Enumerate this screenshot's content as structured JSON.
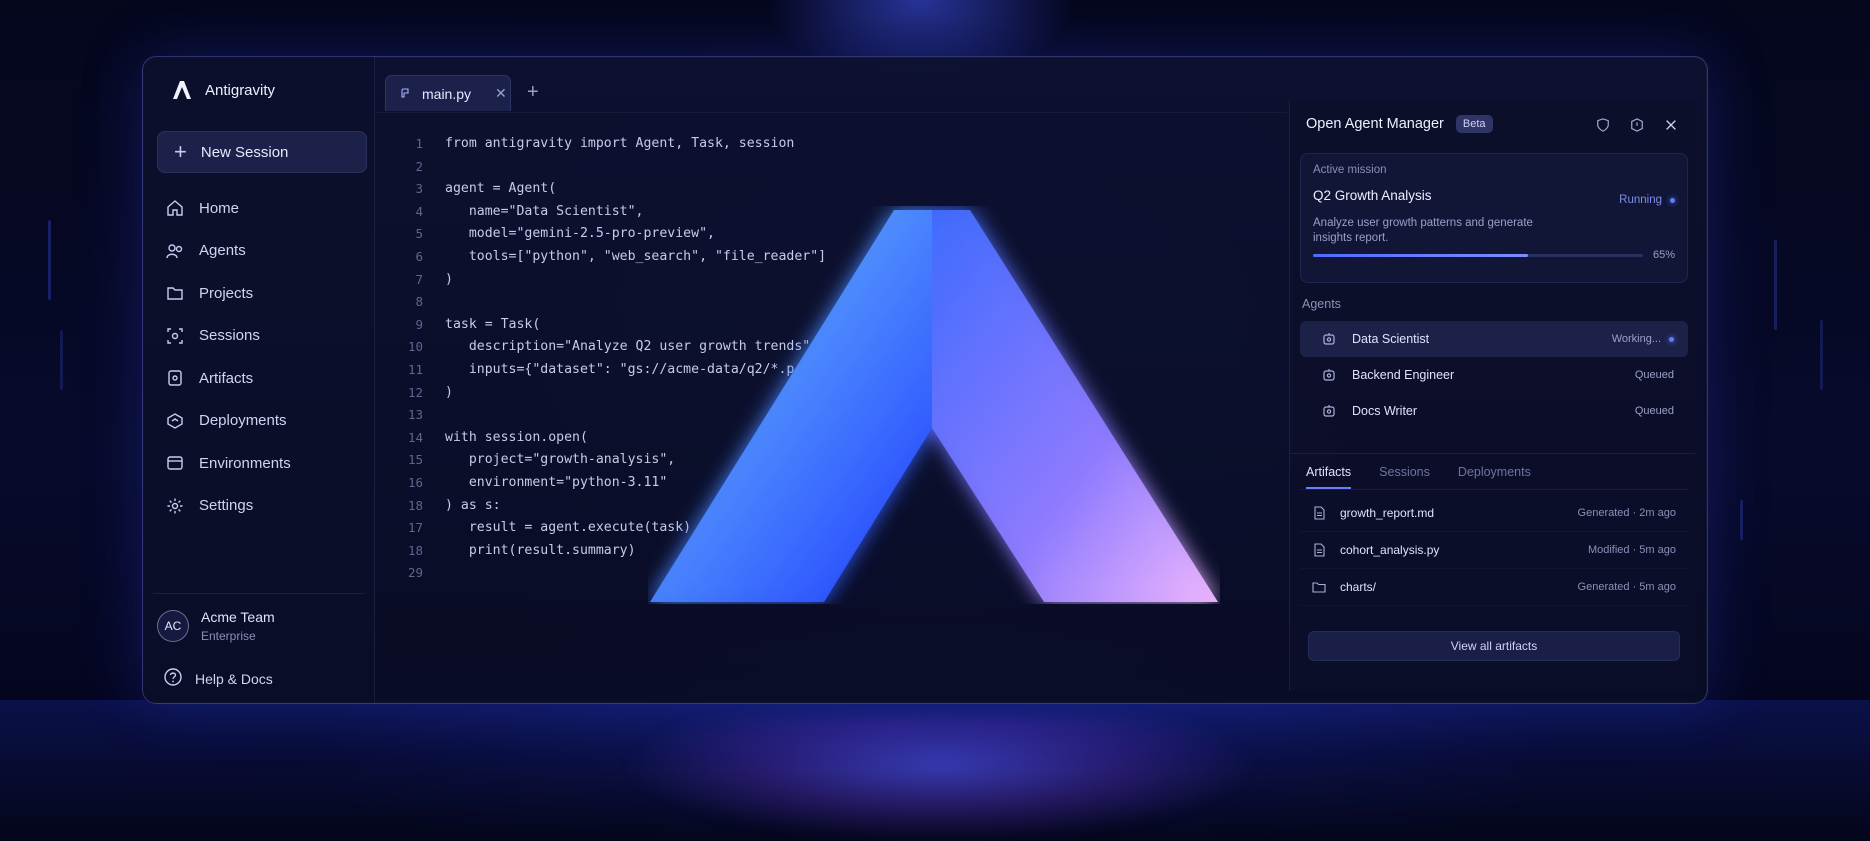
{
  "app": {
    "name": "Antigravity"
  },
  "sidebar": {
    "new_session_label": "New Session",
    "items": [
      {
        "label": "Home",
        "icon": "home-icon"
      },
      {
        "label": "Agents",
        "icon": "agents-icon"
      },
      {
        "label": "Projects",
        "icon": "folder-icon"
      },
      {
        "label": "Sessions",
        "icon": "sessions-icon"
      },
      {
        "label": "Artifacts",
        "icon": "artifact-icon"
      },
      {
        "label": "Deployments",
        "icon": "deploy-icon"
      },
      {
        "label": "Environments",
        "icon": "environment-icon"
      },
      {
        "label": "Settings",
        "icon": "gear-icon"
      }
    ],
    "team": {
      "initials": "AC",
      "name": "Acme Team",
      "plan": "Enterprise"
    },
    "help_label": "Help & Docs"
  },
  "editor": {
    "tab": {
      "filename": "main.py"
    },
    "lines": [
      {
        "n": "1",
        "code": "from antigravity import Agent, Task, session"
      },
      {
        "n": "2",
        "code": ""
      },
      {
        "n": "3",
        "code": "agent = Agent("
      },
      {
        "n": "4",
        "code": "   name=\"Data Scientist\","
      },
      {
        "n": "5",
        "code": "   model=\"gemini-2.5-pro-preview\","
      },
      {
        "n": "6",
        "code": "   tools=[\"python\", \"web_search\", \"file_reader\"]"
      },
      {
        "n": "7",
        "code": ")"
      },
      {
        "n": "8",
        "code": ""
      },
      {
        "n": "9",
        "code": "task = Task("
      },
      {
        "n": "10",
        "code": "   description=\"Analyze Q2 user growth trends\""
      },
      {
        "n": "11",
        "code": "   inputs={\"dataset\": \"gs://acme-data/q2/*.p"
      },
      {
        "n": "12",
        "code": ")"
      },
      {
        "n": "13",
        "code": ""
      },
      {
        "n": "14",
        "code": "with session.open("
      },
      {
        "n": "15",
        "code": "   project=\"growth-analysis\","
      },
      {
        "n": "16",
        "code": "   environment=\"python-3.11\""
      },
      {
        "n": "18",
        "code": ") as s:"
      },
      {
        "n": "17",
        "code": "   result = agent.execute(task)"
      },
      {
        "n": "18",
        "code": "   print(result.summary)"
      },
      {
        "n": "29",
        "code": ""
      }
    ]
  },
  "panel": {
    "title": "Open Agent Manager",
    "badge": "Beta",
    "mission": {
      "label": "Active mission",
      "title": "Q2 Growth Analysis",
      "status": "Running",
      "description": "Analyze user growth patterns and generate insights report.",
      "progress": 0.65,
      "progress_label": "65%"
    },
    "agents_label": "Agents",
    "agents": [
      {
        "name": "Data Scientist",
        "status": "Working...",
        "active": true
      },
      {
        "name": "Backend Engineer",
        "status": "Queued",
        "active": false
      },
      {
        "name": "Docs Writer",
        "status": "Queued",
        "active": false
      }
    ],
    "tabs": [
      "Artifacts",
      "Sessions",
      "Deployments"
    ],
    "files": [
      {
        "name": "growth_report.md",
        "status": "Generated",
        "time": "2m ago",
        "icon": "file-icon"
      },
      {
        "name": "cohort_analysis.py",
        "status": "Modified",
        "time": "5m ago",
        "icon": "file-icon"
      },
      {
        "name": "charts/",
        "status": "Generated",
        "time": "5m ago",
        "icon": "folder-icon"
      }
    ],
    "view_all_label": "View all artifacts"
  },
  "colors": {
    "accent": "#5d7bff",
    "logo_left": "#2f5bff",
    "logo_right": "#c98bff",
    "background": "#04061a"
  }
}
